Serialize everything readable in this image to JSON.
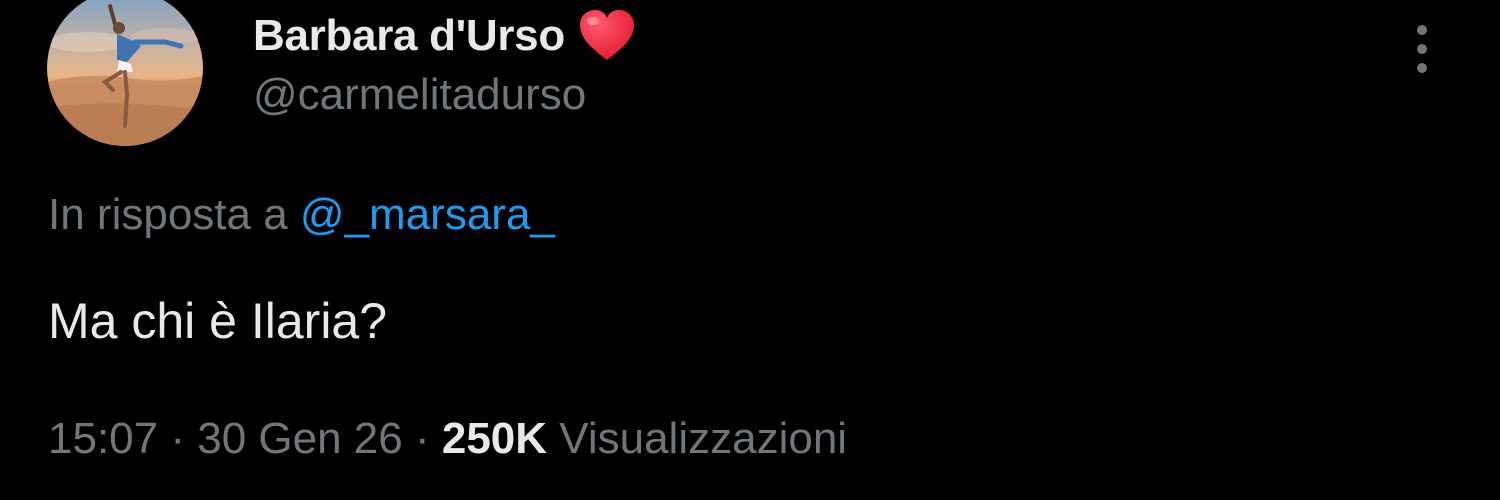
{
  "author": {
    "display_name": "Barbara d'Urso",
    "name_emoji_icon": "red-heart-icon",
    "handle": "@carmelitadurso",
    "avatar_icon": "profile-photo-dancer-on-beach"
  },
  "menu": {
    "more_icon": "vertical-ellipsis-icon"
  },
  "reply": {
    "prefix": "In risposta a",
    "mention": "@_marsara_"
  },
  "tweet": {
    "text": "Ma chi è Ilaria?"
  },
  "meta": {
    "time": "15:07",
    "separator_1": "·",
    "date": "30 Gen 26",
    "separator_2": "·",
    "views_count": "250K",
    "views_label": "Visualizzazioni"
  },
  "colors": {
    "background": "#000000",
    "primary_text": "#e7e9ea",
    "secondary_text": "#71767b",
    "link": "#1d9bf0",
    "heart": "#f4213b"
  }
}
